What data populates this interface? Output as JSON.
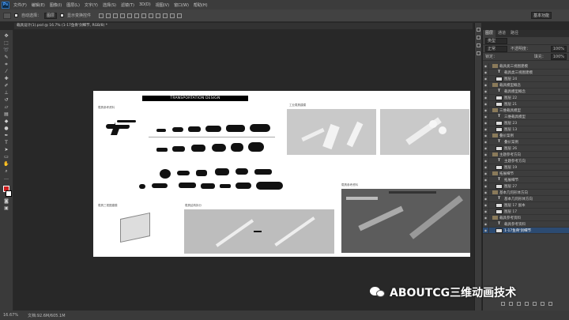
{
  "app": {
    "logo": "Ps"
  },
  "menu": [
    "文件(F)",
    "编辑(E)",
    "图像(I)",
    "图层(L)",
    "文字(Y)",
    "选择(S)",
    "滤镜(T)",
    "3D(D)",
    "视图(V)",
    "窗口(W)",
    "帮助(H)"
  ],
  "options": {
    "auto_select_label": "自动选择：",
    "auto_select_value": "图层",
    "transform_label": "显示变换控件",
    "workspace": "基本功能"
  },
  "document_tab": "载具设计(1).psd @ 16.7% (1-17鱼骨'剑细节, RGB/8) *",
  "canvas": {
    "header": "TRANSPORTATION DESIGN",
    "labels": {
      "l1": "载具参考资料",
      "l2": "工业载具建模",
      "l3": "载具三视图建模",
      "l4": "载具结构拆分",
      "l5": "载具参考资料"
    }
  },
  "status": {
    "zoom": "16.67%",
    "doc": "文档:92.6M/605.1M"
  },
  "layers_panel": {
    "tabs": [
      "图层",
      "通道",
      "路径"
    ],
    "kind_label": "类型",
    "mode_label": "正常",
    "opacity_label": "不透明度：",
    "opacity_value": "100%",
    "lock_label": "锁定：",
    "fill_label": "填充：",
    "fill_value": "100%",
    "rows": [
      {
        "type": "group",
        "name": "载具类三视图建模"
      },
      {
        "type": "text",
        "name": "载具类三视图建模"
      },
      {
        "type": "layer",
        "name": "图层 24"
      },
      {
        "type": "group",
        "name": "载具模型概念"
      },
      {
        "type": "text",
        "name": "载具模型概念"
      },
      {
        "type": "layer",
        "name": "图层 22"
      },
      {
        "type": "layer",
        "name": "图层 21"
      },
      {
        "type": "group",
        "name": "三维载具模型"
      },
      {
        "type": "text",
        "name": "三维载具模型"
      },
      {
        "type": "layer",
        "name": "图层 23"
      },
      {
        "type": "layer",
        "name": "图层 13"
      },
      {
        "type": "group",
        "name": "叠价案例"
      },
      {
        "type": "text",
        "name": "叠价案例"
      },
      {
        "type": "layer",
        "name": "图层 26"
      },
      {
        "type": "group",
        "name": "主题参考方向"
      },
      {
        "type": "text",
        "name": "主题参考方向"
      },
      {
        "type": "layer",
        "name": "图层 19"
      },
      {
        "type": "group",
        "name": "拓展细节"
      },
      {
        "type": "text",
        "name": "拓展细节"
      },
      {
        "type": "layer",
        "name": "图层 27"
      },
      {
        "type": "group",
        "name": "基本几何形体方向"
      },
      {
        "type": "text",
        "name": "基本几何形体方向"
      },
      {
        "type": "layer",
        "name": "图层 17 副本"
      },
      {
        "type": "layer",
        "name": "图层 17"
      },
      {
        "type": "group",
        "name": "载具参考资料"
      },
      {
        "type": "text",
        "name": "载具参考资料"
      },
      {
        "type": "layer",
        "name": "1-17鱼骨'剑细节",
        "selected": true
      }
    ]
  },
  "watermark": "ABOUTCG三维动画技术"
}
